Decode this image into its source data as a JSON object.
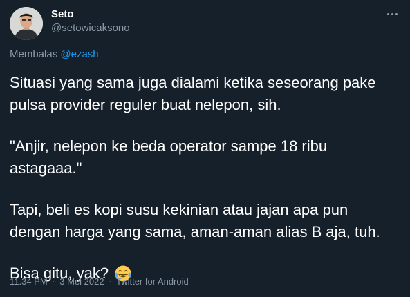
{
  "author": {
    "display_name": "Seto",
    "handle": "@setowicaksono",
    "avatar_icon": "avatar-photo"
  },
  "reply": {
    "prefix": "Membalas",
    "mention": "@ezash"
  },
  "body": {
    "paragraph_1": "Situasi yang sama juga dialami ketika seseorang pake pulsa provider reguler buat nelepon, sih.",
    "paragraph_2": "\"Anjir, nelepon ke beda operator sampe 18 ribu astagaaa.\"",
    "paragraph_3": "Tapi, beli es kopi susu kekinian atau jajan apa pun dengan harga yang sama, aman-aman alias B aja, tuh.",
    "paragraph_4": "Bisa gitu, yak?",
    "emoji_icon": "face-with-tears-of-joy-emoji"
  },
  "meta": {
    "time": "11.34 PM",
    "date": "3 Mei 2022",
    "source": "Twitter for Android",
    "separator": "·"
  },
  "colors": {
    "background": "#15202b",
    "primary_text": "#ffffff",
    "secondary_text": "#8b98a5",
    "accent": "#1d9bf0"
  }
}
